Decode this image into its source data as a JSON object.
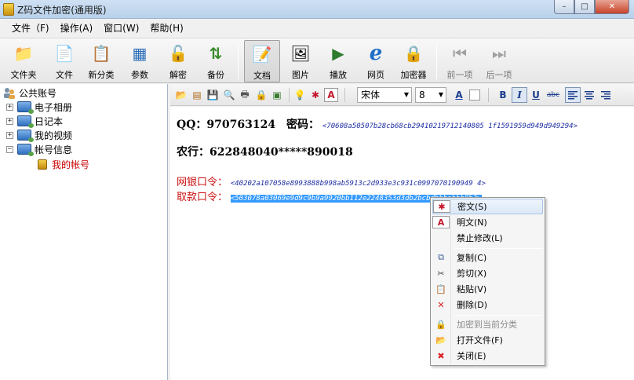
{
  "window": {
    "title": "Z码文件加密(通用版)",
    "min": "–",
    "max": "□",
    "close": "✕"
  },
  "menu": [
    "文件（F)",
    "操作(A)",
    "窗口(W)",
    "帮助(H)"
  ],
  "toolbar": [
    {
      "label": "文件夹",
      "icon": "folder-icon",
      "glyph": "📁"
    },
    {
      "label": "文件",
      "icon": "file-icon",
      "glyph": "📄"
    },
    {
      "label": "新分类",
      "icon": "new-category-icon",
      "glyph": "📋"
    },
    {
      "label": "参数",
      "icon": "parameters-icon",
      "glyph": "▦"
    },
    {
      "label": "解密",
      "icon": "decrypt-lock-icon",
      "glyph": "🔓"
    },
    {
      "label": "备份",
      "icon": "backup-icon",
      "glyph": "⇅"
    },
    {
      "label": "文档",
      "icon": "document-icon",
      "glyph": "📝"
    },
    {
      "label": "图片",
      "icon": "picture-icon",
      "glyph": "🖼"
    },
    {
      "label": "播放",
      "icon": "play-icon",
      "glyph": "▶"
    },
    {
      "label": "网页",
      "icon": "webpage-icon",
      "glyph": "e"
    },
    {
      "label": "加密器",
      "icon": "encryptor-lock-icon",
      "glyph": "🔒"
    },
    {
      "label": "前一项",
      "icon": "previous-icon",
      "glyph": "⏮"
    },
    {
      "label": "后一项",
      "icon": "next-icon",
      "glyph": "⏭"
    }
  ],
  "tree": {
    "root": "公共账号",
    "items": [
      {
        "label": "电子相册",
        "expander": "+"
      },
      {
        "label": "日记本",
        "expander": "+"
      },
      {
        "label": "我的视频",
        "expander": "+"
      },
      {
        "label": "帐号信息",
        "expander": "−"
      }
    ],
    "child": "我的帐号"
  },
  "editor_toolbar": {
    "font": "宋体",
    "size": "8",
    "bold": "B",
    "italic": "I",
    "underline": "U",
    "strike": "abc",
    "underline_char": "A"
  },
  "content": {
    "qq_label": "QQ：970763124　密码：",
    "qq_hash": "<70608a50507b28cb68cb29410219712140805 1f1591959d949d949294>",
    "bank_label": "农行：622848040*****890018",
    "netbank_label": "网银口令：",
    "netbank_hash": "<40202a107058e8993888b998ab5913c2d933e3c931c0997070190949 4>",
    "withdraw_label": "取款口令：",
    "withdraw_hash": "<503078a03069e9d9c9b9a9920bb112e2248353d3db2bcbdbbhabbh8b3>"
  },
  "context_menu": [
    {
      "label": "密文(S)",
      "icon": "ciphertext-icon",
      "glyph": "✱",
      "highlight": true
    },
    {
      "label": "明文(N)",
      "icon": "plaintext-icon",
      "glyph": "A"
    },
    {
      "label": "禁止修改(L)",
      "icon": "",
      "glyph": ""
    },
    {
      "label": "复制(C)",
      "icon": "copy-icon",
      "glyph": "⧉"
    },
    {
      "label": "剪切(X)",
      "icon": "cut-icon",
      "glyph": "✂"
    },
    {
      "label": "粘贴(V)",
      "icon": "paste-icon",
      "glyph": "📋"
    },
    {
      "label": "删除(D)",
      "icon": "delete-icon",
      "glyph": "✕"
    },
    {
      "label": "加密到当前分类",
      "icon": "encrypt-lock-icon",
      "glyph": "🔒",
      "disabled": true
    },
    {
      "label": "打开文件(F)",
      "icon": "open-folder-icon",
      "glyph": "📂"
    },
    {
      "label": "关闭(E)",
      "icon": "close-red-icon",
      "glyph": "✖"
    }
  ]
}
